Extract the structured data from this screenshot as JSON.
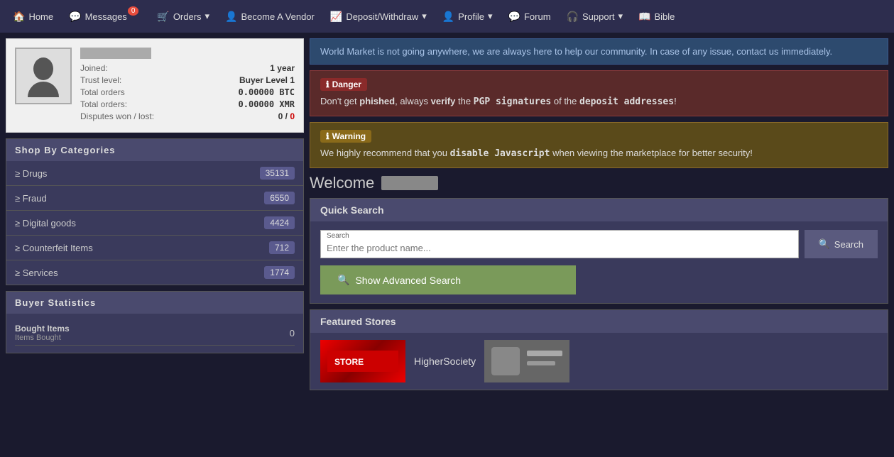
{
  "nav": {
    "items": [
      {
        "label": "Home",
        "icon": "🏠",
        "badge": null
      },
      {
        "label": "Messages",
        "icon": "💬",
        "badge": "0"
      },
      {
        "label": "Orders",
        "icon": "🛒",
        "badge": null,
        "dropdown": true
      },
      {
        "label": "Become A Vendor",
        "icon": "👤",
        "badge": null
      },
      {
        "label": "Deposit/Withdraw",
        "icon": "📈",
        "badge": null,
        "dropdown": true
      },
      {
        "label": "Profile",
        "icon": "👤",
        "badge": null,
        "dropdown": true
      },
      {
        "label": "Forum",
        "icon": "💬",
        "badge": null
      },
      {
        "label": "Support",
        "icon": "🎧",
        "badge": null,
        "dropdown": true
      },
      {
        "label": "Bible",
        "icon": "📖",
        "badge": null
      }
    ]
  },
  "profile": {
    "joined_label": "Joined:",
    "joined_value": "1 year",
    "trust_label": "Trust level:",
    "trust_value": "Buyer Level 1",
    "total_orders_btc_label": "Total orders",
    "total_orders_btc_value": "0.00000 BTC",
    "total_orders_xmr_label": "Total orders:",
    "total_orders_xmr_value": "0.00000 XMR",
    "disputes_label": "Disputes won / lost:",
    "disputes_value": "0 / 0"
  },
  "categories": {
    "header": "Shop By Categories",
    "items": [
      {
        "label": "≥ Drugs",
        "count": "35131"
      },
      {
        "label": "≥ Fraud",
        "count": "6550"
      },
      {
        "label": "≥ Digital goods",
        "count": "4424"
      },
      {
        "label": "≥ Counterfeit Items",
        "count": "712"
      },
      {
        "label": "≥ Services",
        "count": "1774"
      }
    ]
  },
  "buyer_stats": {
    "header": "Buyer Statistics",
    "bought_label": "Bought Items",
    "bought_sublabel": "Items Bought",
    "bought_value": "0"
  },
  "alerts": {
    "world_msg": "World Market is not going anywhere, we are always here to help our community. In case of any issue, contact us immediately.",
    "danger_badge": "Danger",
    "danger_text_prefix": "Don't get ",
    "danger_bold1": "phished",
    "danger_text1": ", always ",
    "danger_bold2": "verify",
    "danger_text2": " the ",
    "danger_bold3": "PGP signatures",
    "danger_text3": " of the ",
    "danger_bold4": "deposit addresses",
    "danger_text4": "!",
    "warning_badge": "Warning",
    "warning_text_prefix": "We highly recommend that you ",
    "warning_bold": "disable Javascript",
    "warning_text_suffix": " when viewing the marketplace for better security!"
  },
  "welcome": {
    "text": "Welcome"
  },
  "quick_search": {
    "header": "Quick Search",
    "input_label": "Search",
    "input_placeholder": "Enter the product name...",
    "search_button": "Search",
    "advanced_button": "Show Advanced Search"
  },
  "featured_stores": {
    "header": "Featured Stores",
    "stores": [
      {
        "name": "HigherSociety"
      }
    ]
  }
}
